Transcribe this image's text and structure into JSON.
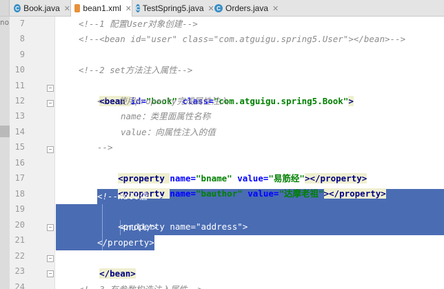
{
  "tabs": [
    {
      "label": "Book.java",
      "type": "java",
      "active": false
    },
    {
      "label": "bean1.xml",
      "type": "xml",
      "active": true
    },
    {
      "label": "TestSpring5.java",
      "type": "java",
      "active": false
    },
    {
      "label": "Orders.java",
      "type": "java",
      "active": false
    }
  ],
  "gutter_edge_text": "no",
  "lines": [
    {
      "num": "7",
      "text": "<!--1 配置User对象创建-->"
    },
    {
      "num": "8",
      "text": "<!--<bean id=\"user\" class=\"com.atguigu.spring5.User\"></bean>-->"
    },
    {
      "num": "9",
      "text": ""
    },
    {
      "num": "10",
      "text": "<!--2 set方法注入属性-->"
    },
    {
      "num": "11",
      "p1": "<bean ",
      "p2": "id=",
      "p3": "\"book\" ",
      "p4": "class=",
      "p5": "\"com.atguigu.spring5.Book\"",
      "p6": ">"
    },
    {
      "num": "12",
      "text": "<!--使用property完成属性注入"
    },
    {
      "num": "13",
      "text": "name：类里面属性名称"
    },
    {
      "num": "14",
      "text": "value：向属性注入的值"
    },
    {
      "num": "15",
      "text": "-->"
    },
    {
      "num": "16",
      "p1": "<property ",
      "p2": "name=",
      "p3": "\"bname\" ",
      "p4": "value=",
      "p5": "\"易筋经\"",
      "p6": "></property>"
    },
    {
      "num": "17",
      "p1": "<property ",
      "p2": "name=",
      "p3": "\"bauthor\" ",
      "p4": "value=",
      "p5": "\"达摩老祖\"",
      "p6": "></property>"
    },
    {
      "num": "18",
      "text": "<!--null值-->"
    },
    {
      "num": "19",
      "p1": "<property ",
      "p2": "name=",
      "p3": "\"address\"",
      "p4": ">"
    },
    {
      "num": "20",
      "text": "<null/>"
    },
    {
      "num": "21",
      "text": "</property>"
    },
    {
      "num": "22",
      "text": "</bean>"
    },
    {
      "num": "23",
      "text": ""
    },
    {
      "num": "24",
      "text": "<!--3 有参数构造注入属性-->"
    }
  ],
  "colors": {
    "selection": "#4a6cb3",
    "comment": "#8c8c8c",
    "tag": "#000080",
    "attr": "#0000ff",
    "value": "#008000"
  }
}
